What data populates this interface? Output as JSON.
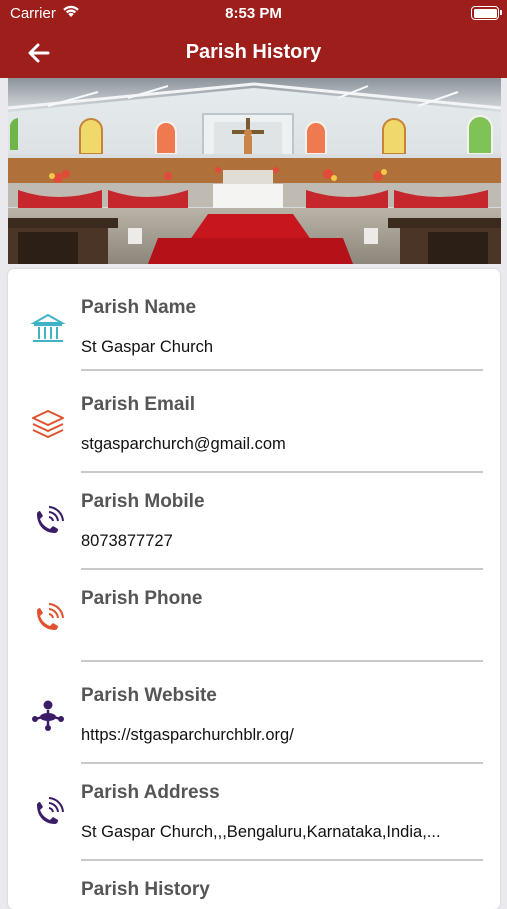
{
  "status": {
    "carrier": "Carrier",
    "time": "8:53 PM"
  },
  "nav": {
    "title": "Parish History"
  },
  "fields": [
    {
      "label": "Parish Name",
      "value": "St Gaspar Church",
      "icon": "building-icon"
    },
    {
      "label": "Parish Email",
      "value": "stgasparchurch@gmail.com",
      "icon": "layers-icon"
    },
    {
      "label": "Parish Mobile",
      "value": "8073877727",
      "icon": "phone-icon"
    },
    {
      "label": "Parish Phone",
      "value": "",
      "icon": "phone-icon"
    },
    {
      "label": "Parish Website",
      "value": "https://stgasparchurchblr.org/",
      "icon": "network-icon"
    },
    {
      "label": "Parish Address",
      "value": "St Gaspar Church,,,Bengaluru,Karnataka,India,...",
      "icon": "phone-icon"
    },
    {
      "label": "Parish History",
      "value": "",
      "icon": ""
    }
  ],
  "colors": {
    "brand": "#9d1e1b",
    "teal": "#3fb2c4",
    "orange": "#e0522d",
    "purple": "#3a1d66"
  }
}
